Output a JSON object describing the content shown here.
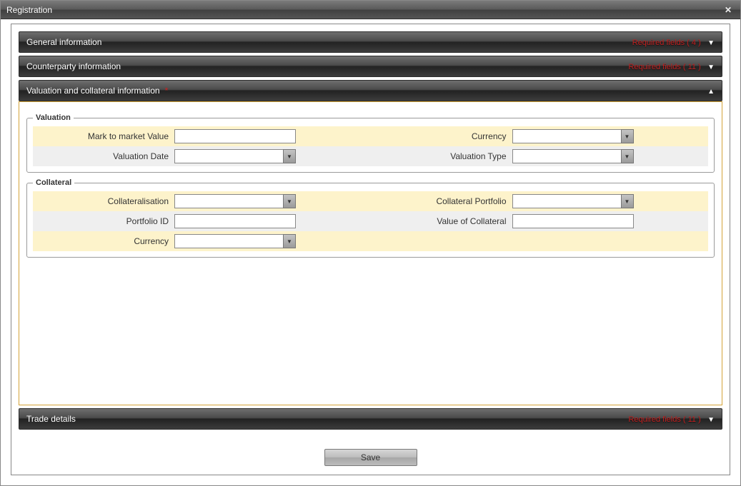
{
  "window": {
    "title": "Registration"
  },
  "accordion": {
    "general": {
      "title": "General information",
      "required_label": "Required fields ( 4 )"
    },
    "counterparty": {
      "title": "Counterparty information",
      "required_label": "Required fields ( 11 )"
    },
    "valuation": {
      "title": "Valuation and collateral information"
    },
    "trade": {
      "title": "Trade details",
      "required_label": "Required fields ( 11 )"
    }
  },
  "valuation_group": {
    "legend": "Valuation",
    "mark_to_market_label": "Mark to market Value",
    "mark_to_market_value": "",
    "currency_label": "Currency",
    "currency_value": "",
    "valuation_date_label": "Valuation Date",
    "valuation_date_value": "",
    "valuation_type_label": "Valuation Type",
    "valuation_type_value": ""
  },
  "collateral_group": {
    "legend": "Collateral",
    "collateralisation_label": "Collateralisation",
    "collateralisation_value": "",
    "collateral_portfolio_label": "Collateral Portfolio",
    "collateral_portfolio_value": "",
    "portfolio_id_label": "Portfolio ID",
    "portfolio_id_value": "",
    "value_of_collateral_label": "Value of Collateral",
    "value_of_collateral_value": "",
    "currency_label": "Currency",
    "currency_value": ""
  },
  "buttons": {
    "save": "Save"
  },
  "glyphs": {
    "asterisk": "*",
    "arrow_down": "▼",
    "arrow_up": "▲",
    "close": "✕"
  }
}
